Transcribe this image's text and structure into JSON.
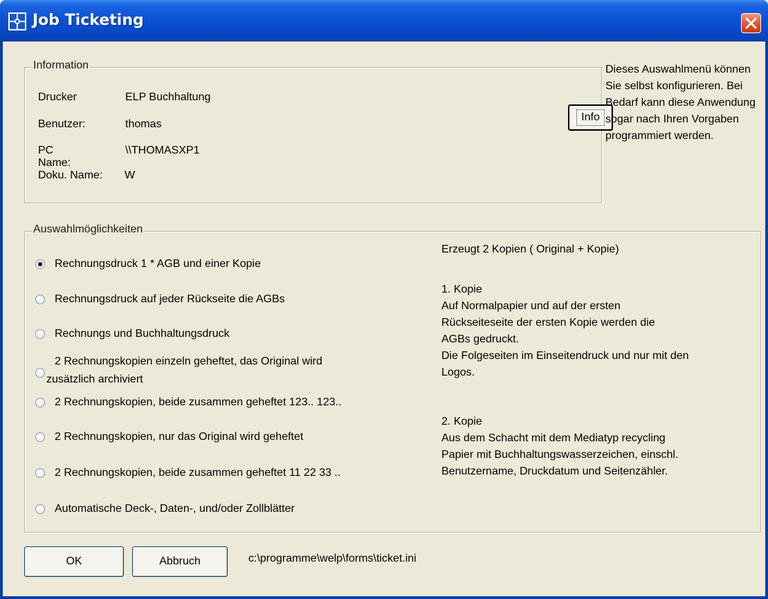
{
  "window": {
    "title": "Job Ticketing",
    "icon": "app-grid-icon"
  },
  "information": {
    "legend": "Information",
    "rows": [
      {
        "label": "Drucker",
        "value": "ELP Buchhaltung"
      },
      {
        "label": "Benutzer:",
        "value": "thomas"
      },
      {
        "label": "PC Name:",
        "value": "\\\\THOMASXP1"
      },
      {
        "label": "Doku. Name:",
        "value": "W"
      }
    ],
    "info_button": "Info"
  },
  "side_note": "Dieses Auswahlmenü können Sie selbst konfigurieren. Bei Bedarf kann diese Anwendung sogar nach Ihren Vorgaben programmiert werden.",
  "choices": {
    "legend": "Auswahlmöglichkeiten",
    "options": [
      {
        "label": "Rechnungsdruck 1 * AGB und einer Kopie",
        "checked": true
      },
      {
        "label": "Rechnungsdruck auf jeder Rückseite die AGBs",
        "checked": false
      },
      {
        "label": "Rechnungs und Buchhaltungsdruck",
        "checked": false
      },
      {
        "label": "2 Rechnungskopien einzeln geheftet, das Original wird",
        "label2": "zusätzlich archiviert",
        "checked": false
      },
      {
        "label": "2 Rechnungskopien, beide zusammen geheftet 123.. 123..",
        "checked": false
      },
      {
        "label": "2 Rechnungskopien, nur das Original wird geheftet",
        "checked": false
      },
      {
        "label": "2 Rechnungskopien, beide zusammen geheftet 11 22 33 ..",
        "checked": false
      },
      {
        "label": "Automatische Deck-, Daten-, und/oder Zollblätter",
        "checked": false
      }
    ],
    "description": {
      "summary": "Erzeugt 2 Kopien  ( Original + Kopie)",
      "copy1": "1. Kopie\nAuf Normalpapier und auf der ersten\nRückseiteseite der ersten Kopie werden die\nAGBs gedruckt.\nDie Folgeseiten im Einseitendruck und nur mit den\nLogos.",
      "copy2": "2. Kopie\nAus dem Schacht mit dem Mediatyp recycling\nPapier mit Buchhaltungswasserzeichen, einschl.\nBenutzername, Druckdatum und Seitenzähler."
    }
  },
  "buttons": {
    "ok": "OK",
    "cancel": "Abbruch"
  },
  "ini_path": "c:\\programme\\welp\\forms\\ticket.ini"
}
